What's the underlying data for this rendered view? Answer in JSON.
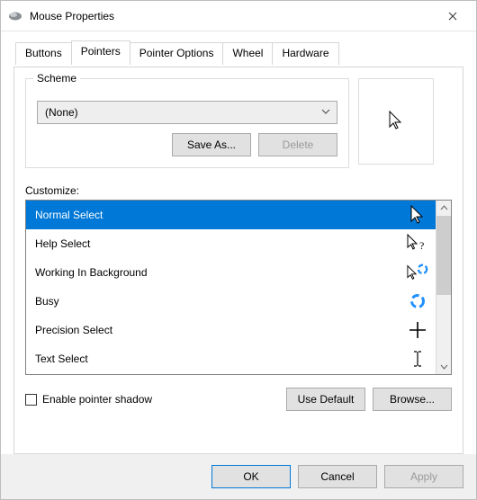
{
  "window": {
    "title": "Mouse Properties"
  },
  "tabs": {
    "buttons": "Buttons",
    "pointers": "Pointers",
    "pointer_options": "Pointer Options",
    "wheel": "Wheel",
    "hardware": "Hardware",
    "active": "pointers"
  },
  "scheme": {
    "group_label": "Scheme",
    "selected": "(None)",
    "save_as": "Save As...",
    "delete": "Delete"
  },
  "customize": {
    "label": "Customize:",
    "items": [
      {
        "label": "Normal Select",
        "icon": "cursor-arrow",
        "selected": true
      },
      {
        "label": "Help Select",
        "icon": "cursor-help",
        "selected": false
      },
      {
        "label": "Working In Background",
        "icon": "cursor-working",
        "selected": false
      },
      {
        "label": "Busy",
        "icon": "cursor-busy",
        "selected": false
      },
      {
        "label": "Precision Select",
        "icon": "cursor-precision",
        "selected": false
      },
      {
        "label": "Text Select",
        "icon": "cursor-text",
        "selected": false
      }
    ]
  },
  "options": {
    "enable_shadow": "Enable pointer shadow",
    "use_default": "Use Default",
    "browse": "Browse..."
  },
  "footer": {
    "ok": "OK",
    "cancel": "Cancel",
    "apply": "Apply"
  }
}
